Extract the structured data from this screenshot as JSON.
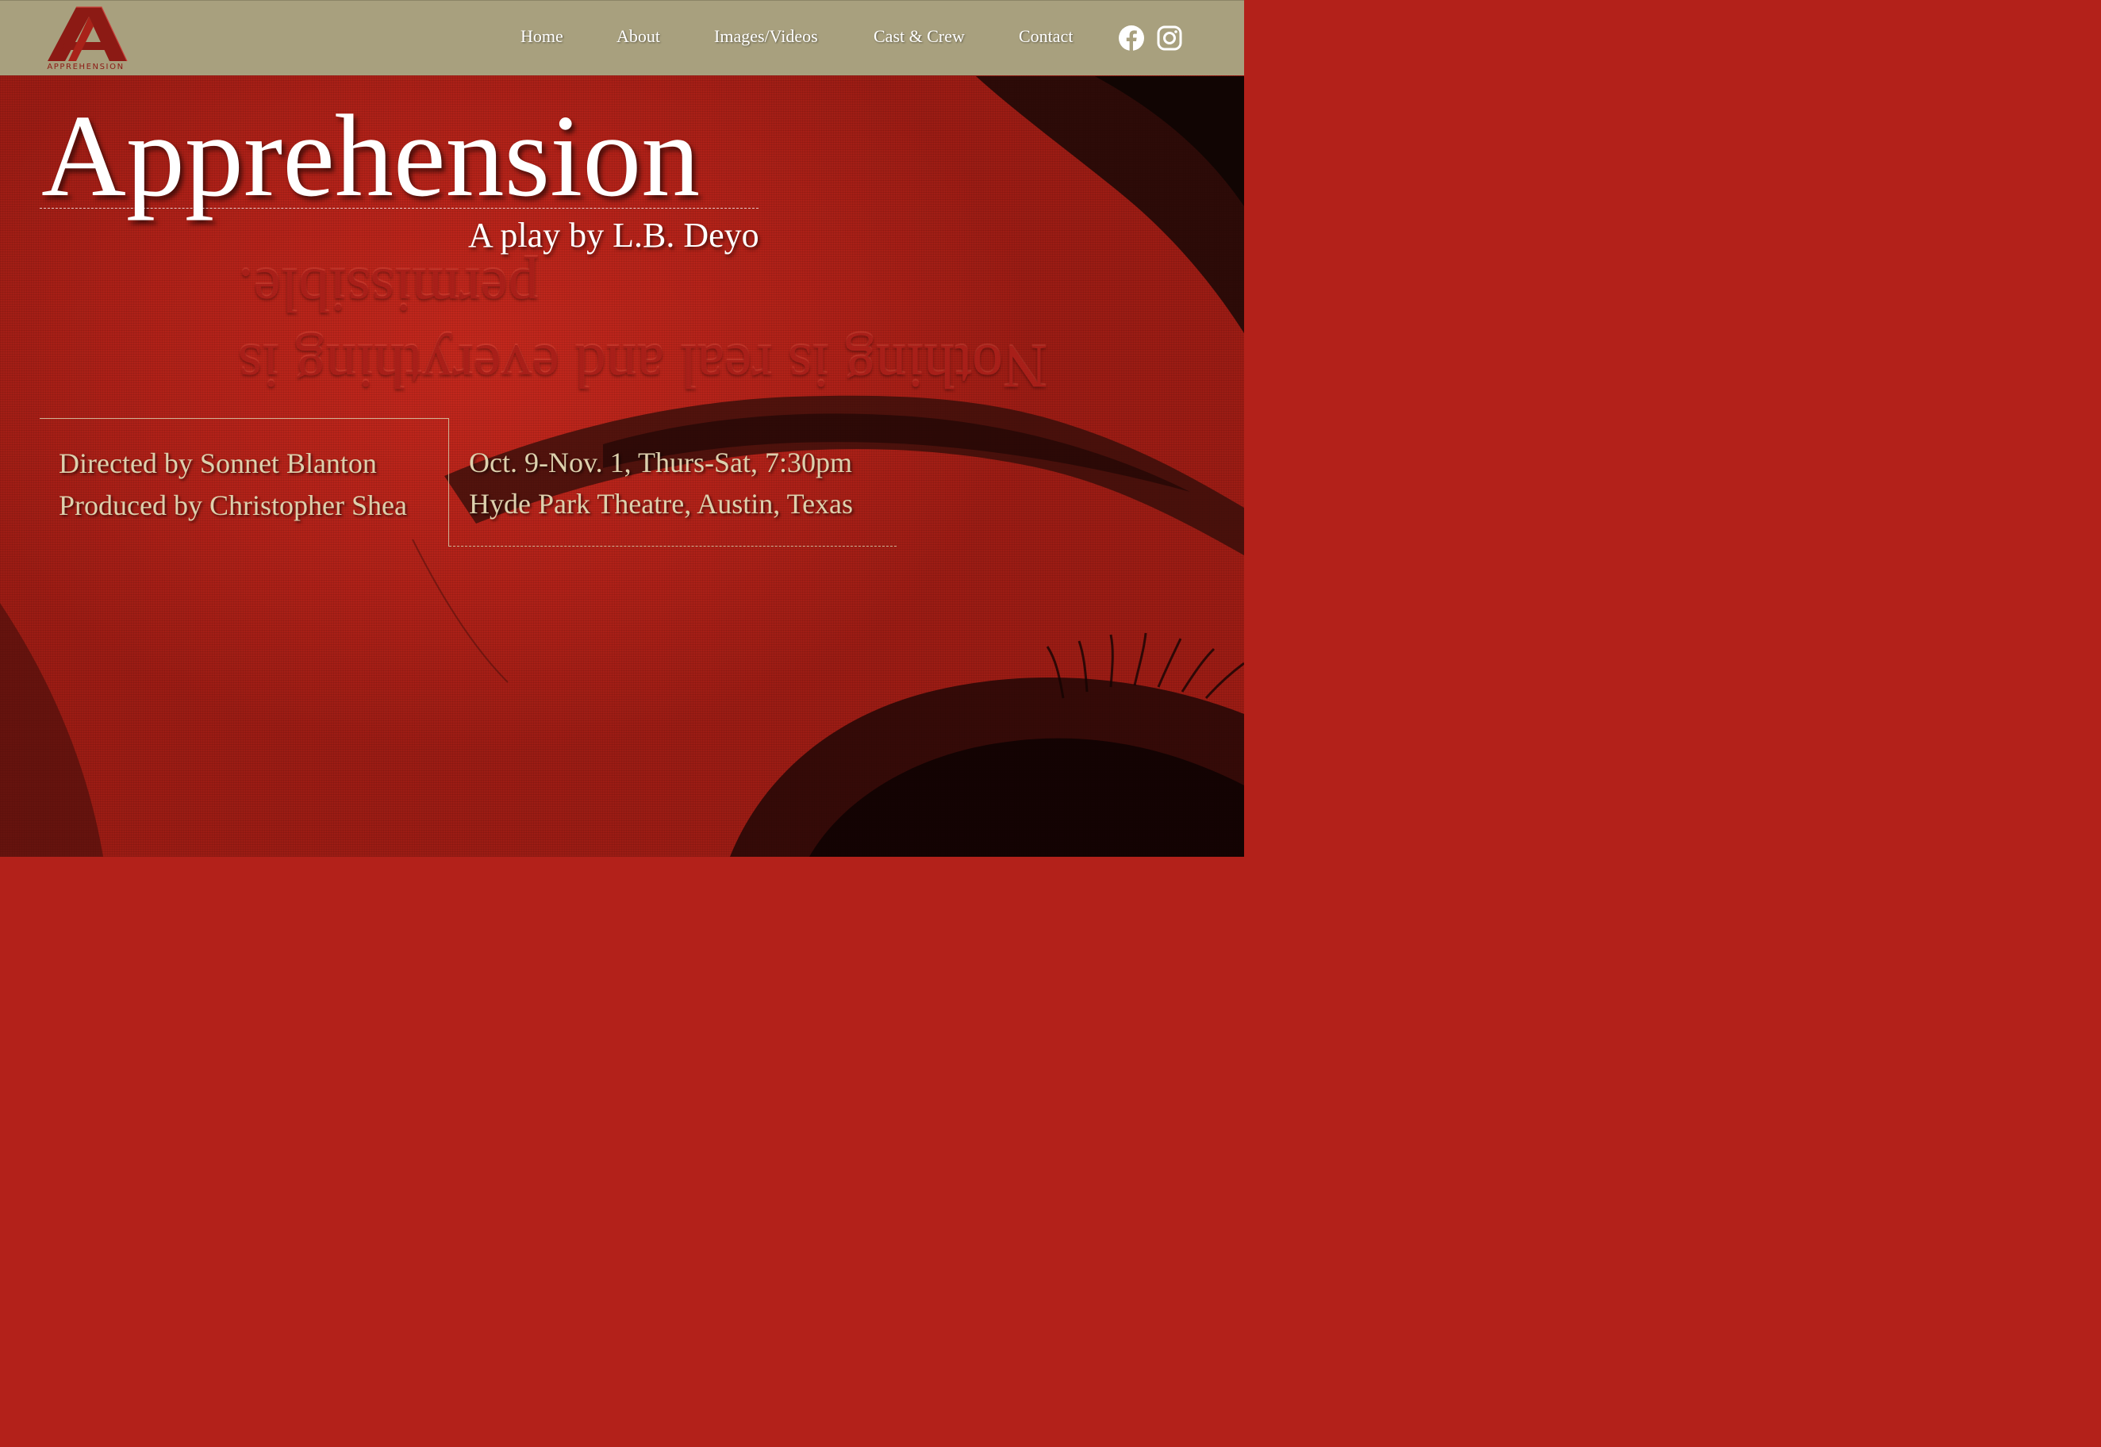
{
  "header": {
    "logo_text": "APPREHENSION",
    "nav": [
      {
        "label": "Home"
      },
      {
        "label": "About"
      },
      {
        "label": "Images/Videos"
      },
      {
        "label": "Cast & Crew"
      },
      {
        "label": "Contact"
      }
    ],
    "social": [
      {
        "icon": "facebook-icon"
      },
      {
        "icon": "instagram-icon"
      }
    ]
  },
  "hero": {
    "title": "Apprehension",
    "subtitle": "A play by L.B. Deyo",
    "tagline_line1": "Nothing is real and everything is",
    "tagline_line2": "permissible."
  },
  "credits": {
    "director": "Directed by Sonnet Blanton",
    "producer": "Produced by Christopher Shea"
  },
  "details": {
    "dates": "Oct. 9-Nov. 1, Thurs-Sat, 7:30pm",
    "venue": "Hyde Park Theatre, Austin, Texas"
  },
  "colors": {
    "header_bg": "#a8a07e",
    "hero_red": "#b3211a",
    "logo_red": "#8c1a14",
    "credit_text": "#ddd0ad",
    "title_text": "#ffffff"
  }
}
